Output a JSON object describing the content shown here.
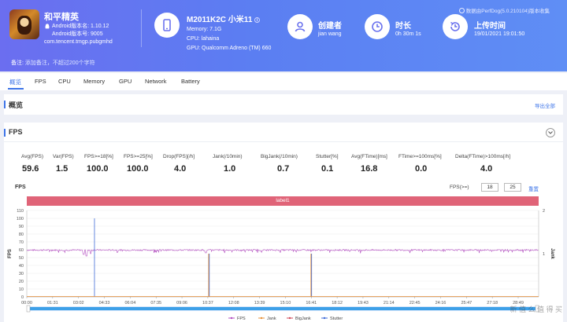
{
  "app": {
    "name": "和平精英",
    "android_version_label": "Android版本名: 1.10.12",
    "android_version_code": "Android版本号: 9005",
    "package": "com.tencent.tmgp.pubgmhd"
  },
  "device": {
    "model": "M2011K2C 小米11",
    "memory": "Memory: 7.1G",
    "cpu": "CPU: lahaina",
    "gpu": "GPU: Qualcomm Adreno (TM) 660"
  },
  "creator": {
    "label": "创建者",
    "value": "jian wang"
  },
  "duration": {
    "label": "时长",
    "value": "0h 30m 1s"
  },
  "upload": {
    "label": "上传时间",
    "value": "19/01/2021 19:01:50"
  },
  "report_tag": "数据由PerfDog(5.0.210104)版本收集",
  "note": {
    "label": "备注:",
    "text": "添加备注，不超过200个字符"
  },
  "tabs": [
    "概览",
    "FPS",
    "CPU",
    "Memory",
    "GPU",
    "Network",
    "Battery"
  ],
  "overview": {
    "title": "概览",
    "export": "导出全部"
  },
  "fps_section": {
    "title": "FPS",
    "metrics": [
      {
        "label": "Avg(FPS)",
        "value": "59.6"
      },
      {
        "label": "Var(FPS)",
        "value": "1.5"
      },
      {
        "label": "FPS>=18[%]",
        "value": "100.0"
      },
      {
        "label": "FPS>=25[%]",
        "value": "100.0"
      },
      {
        "label": "Drop(FPS)[/h]",
        "value": "4.0"
      },
      {
        "label": "Jank(/10min)",
        "value": "1.0"
      },
      {
        "label": "BigJank(/10min)",
        "value": "0.7"
      },
      {
        "label": "Stutter[%]",
        "value": "0.1"
      },
      {
        "label": "Avg(FTime)[ms]",
        "value": "16.8"
      },
      {
        "label": "FTime>=100ms[%]",
        "value": "0.0"
      },
      {
        "label": "Delta(FTime)>100ms[/h]",
        "value": "4.0"
      }
    ],
    "chart_label": "FPS",
    "fps_filter_label": "FPS(>=)",
    "fps_filter_values": [
      "18",
      "25"
    ],
    "reset_label": "重置",
    "label_bar": "label1",
    "watermark": "新 值 么 值 得 买"
  },
  "chart_data": {
    "type": "line",
    "ylabel": "FPS",
    "y2label": "Jank",
    "ylim": [
      0,
      110
    ],
    "y2lim": [
      0,
      2
    ],
    "yticks": [
      0,
      10,
      20,
      30,
      40,
      50,
      60,
      70,
      80,
      90,
      100,
      110
    ],
    "y2ticks": [
      1,
      2
    ],
    "x_ticks": [
      "00:00",
      "01:31",
      "03:02",
      "04:33",
      "06:04",
      "07:35",
      "09:06",
      "10:37",
      "12:08",
      "13:39",
      "15:10",
      "16:41",
      "18:12",
      "19:43",
      "21:14",
      "22:45",
      "24:16",
      "25:47",
      "27:18",
      "28:49"
    ],
    "x_max_seconds": 1801,
    "series": [
      {
        "name": "FPS",
        "color": "#b34fc0",
        "baseline": 59.6,
        "dips": [
          {
            "t": 200,
            "v": 54
          },
          {
            "t": 210,
            "v": 52
          },
          {
            "t": 225,
            "v": 55
          },
          {
            "t": 630,
            "v": 56
          }
        ]
      },
      {
        "name": "Jank",
        "color": "#e8923a",
        "events": [
          {
            "t": 640,
            "v": 1
          },
          {
            "t": 1000,
            "v": 1
          }
        ]
      },
      {
        "name": "BigJank",
        "color": "#d04a5a",
        "events": []
      },
      {
        "name": "Stutter",
        "color": "#3f6bd8",
        "events": [
          {
            "t": 236,
            "v": 100
          },
          {
            "t": 640,
            "v": 1
          },
          {
            "t": 1000,
            "v": 1
          }
        ]
      }
    ],
    "legend_position": "bottom"
  }
}
